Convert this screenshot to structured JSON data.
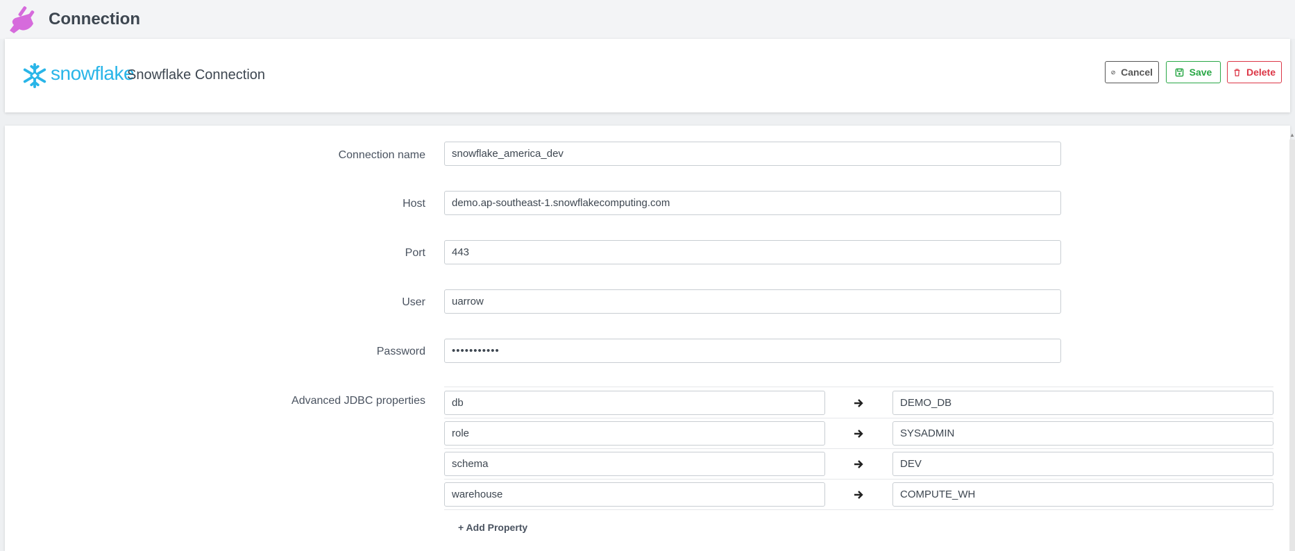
{
  "header": {
    "title": "Connection",
    "icon": "plug-icon",
    "icon_color": "#d66bdc"
  },
  "connection": {
    "brand_word": "snowflake",
    "brand_color": "#29b5e8",
    "title": "Snowflake Connection"
  },
  "actions": {
    "cancel_label": "Cancel",
    "save_label": "Save",
    "delete_label": "Delete"
  },
  "form": {
    "connection_name": {
      "label": "Connection name",
      "value": "snowflake_america_dev"
    },
    "host": {
      "label": "Host",
      "value": "demo.ap-southeast-1.snowflakecomputing.com"
    },
    "port": {
      "label": "Port",
      "value": "443"
    },
    "user": {
      "label": "User",
      "value": "uarrow"
    },
    "password": {
      "label": "Password",
      "value": "•••••••••••"
    },
    "advanced_label": "Advanced JDBC properties",
    "properties": [
      {
        "key": "db",
        "value": "DEMO_DB"
      },
      {
        "key": "role",
        "value": "SYSADMIN"
      },
      {
        "key": "schema",
        "value": "DEV"
      },
      {
        "key": "warehouse",
        "value": "COMPUTE_WH"
      }
    ],
    "add_property_label": "+ Add Property"
  }
}
